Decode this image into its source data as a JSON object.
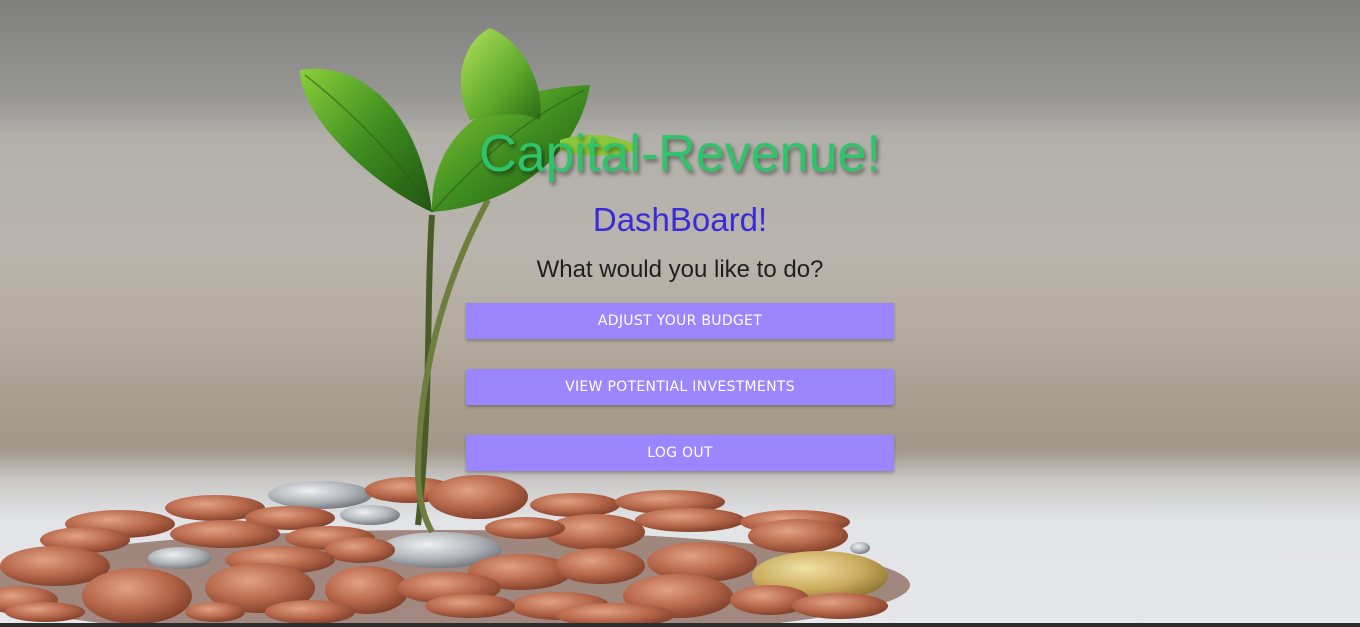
{
  "app": {
    "title": "Capital-Revenue!"
  },
  "page": {
    "heading": "DashBoard!",
    "prompt": "What would you like to do?"
  },
  "actions": [
    {
      "label": "ADJUST YOUR BUDGET"
    },
    {
      "label": "VIEW POTENTIAL INVESTMENTS"
    },
    {
      "label": "LOG OUT"
    }
  ],
  "theme": {
    "title_color": "#2fc46b",
    "heading_color": "#3a2bd8",
    "button_color": "#9c86ff",
    "button_text_color": "#ffffff"
  },
  "background": {
    "image": "sprout-growing-from-pile-of-coins"
  }
}
